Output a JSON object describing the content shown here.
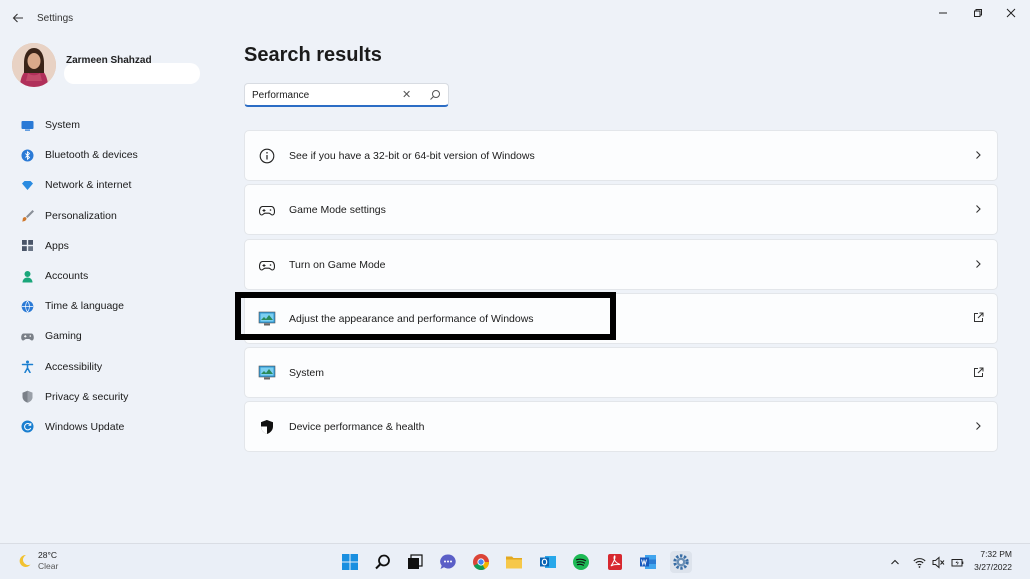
{
  "window": {
    "title": "Settings"
  },
  "profile": {
    "name": "Zarmeen Shahzad"
  },
  "nav": {
    "items": [
      {
        "label": "System",
        "icon": "monitor-icon",
        "color": "#2a7ad6"
      },
      {
        "label": "Bluetooth & devices",
        "icon": "bluetooth-icon",
        "color": "#2a7ad6"
      },
      {
        "label": "Network & internet",
        "icon": "wifi-diamond-icon",
        "color": "#2a8be0"
      },
      {
        "label": "Personalization",
        "icon": "brush-icon",
        "color": "#c07030"
      },
      {
        "label": "Apps",
        "icon": "apps-grid-icon",
        "color": "#4a5568"
      },
      {
        "label": "Accounts",
        "icon": "person-icon",
        "color": "#1aa67a"
      },
      {
        "label": "Time & language",
        "icon": "globe-clock-icon",
        "color": "#2a7ad6"
      },
      {
        "label": "Gaming",
        "icon": "gamepad-icon",
        "color": "#777"
      },
      {
        "label": "Accessibility",
        "icon": "accessibility-icon",
        "color": "#1a7fd0"
      },
      {
        "label": "Privacy & security",
        "icon": "shield-icon",
        "color": "#777"
      },
      {
        "label": "Windows Update",
        "icon": "update-icon",
        "color": "#1a7fd0"
      }
    ]
  },
  "main": {
    "title": "Search results",
    "search": {
      "value": "Performance"
    },
    "results": [
      {
        "label": "See if you have a 32-bit or 64-bit version of Windows",
        "icon": "info-icon",
        "trail": "chevron-right-icon"
      },
      {
        "label": "Game Mode settings",
        "icon": "gamepad-icon",
        "trail": "chevron-right-icon"
      },
      {
        "label": "Turn on Game Mode",
        "icon": "gamepad-icon",
        "trail": "chevron-right-icon"
      },
      {
        "label": "Adjust the appearance and performance of Windows",
        "icon": "control-panel-icon",
        "trail": "external-link-icon"
      },
      {
        "label": "System",
        "icon": "control-panel-icon",
        "trail": "external-link-icon"
      },
      {
        "label": "Device performance & health",
        "icon": "shield-icon",
        "trail": "chevron-right-icon"
      }
    ]
  },
  "taskbar": {
    "weather": {
      "temp": "28°C",
      "condition": "Clear"
    },
    "clock": {
      "time": "7:32 PM",
      "date": "3/27/2022"
    }
  },
  "colors": {
    "accent": "#2c6dc5",
    "highlight": "#000000"
  }
}
